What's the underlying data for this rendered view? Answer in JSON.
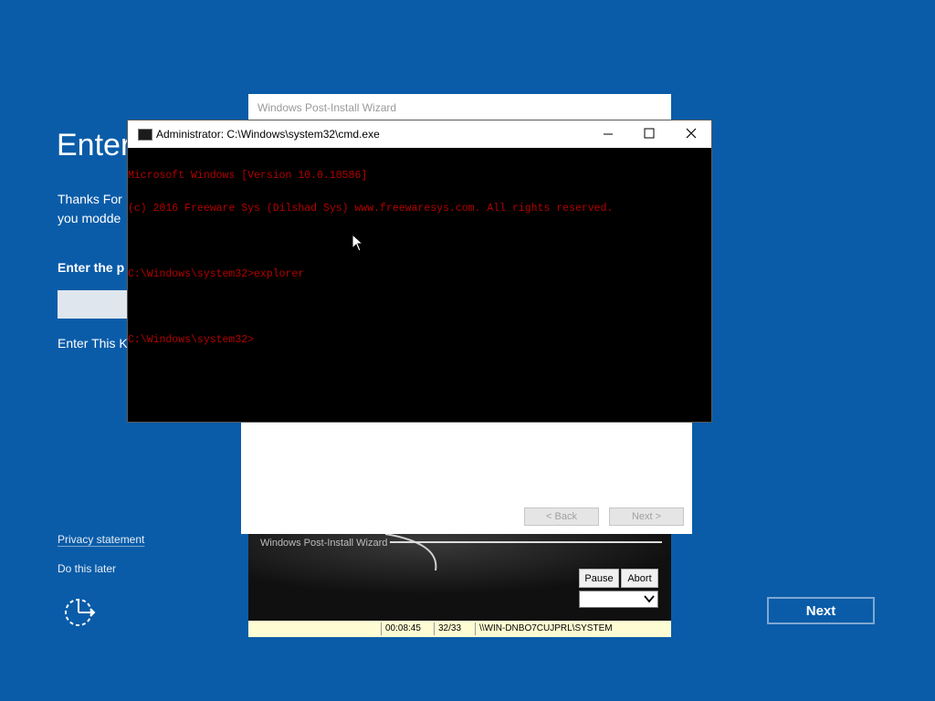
{
  "oobe": {
    "heading": "Enter",
    "thanks_line1": "Thanks For",
    "thanks_line2": "you modde",
    "enter_label": "Enter the p",
    "enter_key_text": "Enter This K",
    "privacy_link": "Privacy statement",
    "later_link": "Do this later",
    "next_label": "Next"
  },
  "wizard": {
    "title": "Windows Post-Install Wizard",
    "back_label": "< Back",
    "next_label": "Next >"
  },
  "progress": {
    "label": "Windows Post-Install Wizard",
    "pause_label": "Pause",
    "abort_label": "Abort",
    "select_value": ""
  },
  "status_bar": {
    "time": "00:08:45",
    "count": "32/33",
    "user": "\\\\WIN-DNBO7CUJPRL\\SYSTEM"
  },
  "cmd": {
    "title": "Administrator: C:\\Windows\\system32\\cmd.exe",
    "lines": [
      "Microsoft Windows [Version 10.0.10586]",
      "(c) 2016 Freeware Sys (Dilshad Sys) www.freewaresys.com. All rights reserved.",
      "",
      "C:\\Windows\\system32>explorer",
      "",
      "C:\\Windows\\system32>"
    ],
    "text_color": "#b40000"
  },
  "colors": {
    "desktop_bg": "#0a5ca8",
    "status_bar_bg": "#fdfcd2"
  },
  "icons": [
    "cmd-icon",
    "minimize-icon",
    "maximize-icon",
    "close-icon",
    "accessibility-icon",
    "chevron-down-icon",
    "mouse-cursor-icon"
  ]
}
